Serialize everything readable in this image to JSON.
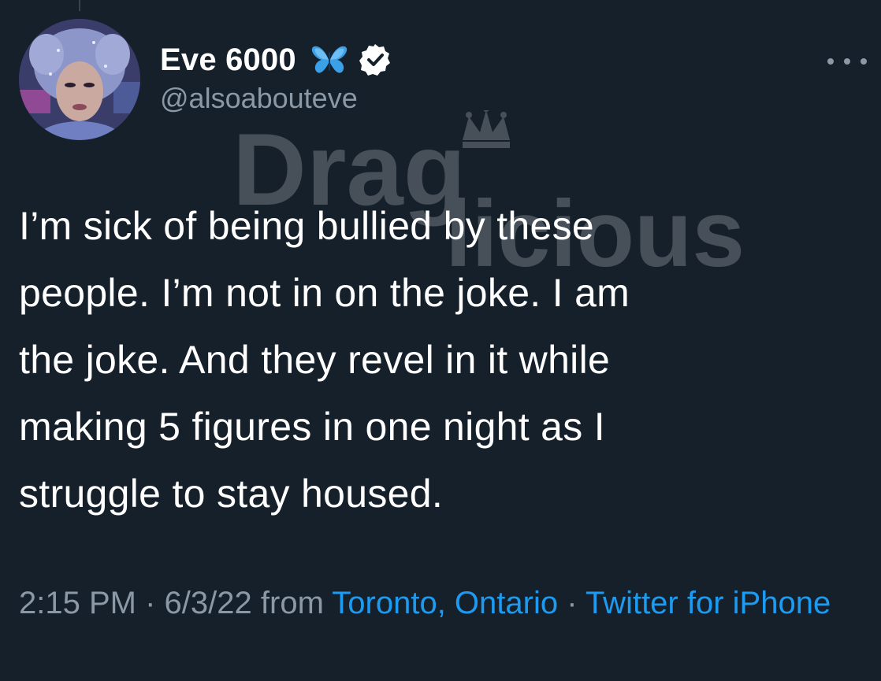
{
  "tweet": {
    "author": {
      "display_name": "Eve 6000",
      "handle": "@alsoabouteve",
      "avatar_icon": "avatar",
      "badge_icons": [
        "butterfly-emoji",
        "verified-badge-icon"
      ]
    },
    "text": "I’m sick of being bullied by these\npeople. I’m not in on the joke. I am\nthe joke. And they revel in it while\nmaking 5 figures in one night as I\nstruggle to stay housed.",
    "time": "2:15 PM",
    "date": "6/3/22",
    "from_label": "from",
    "location": "Toronto, Ontario",
    "separator": "·",
    "client": "Twitter for iPhone"
  },
  "watermark": {
    "text_top": "Drag",
    "text_bottom": "licious"
  },
  "colors": {
    "background": "#15202b",
    "text_primary": "#ffffff",
    "text_secondary": "#8b98a5",
    "link": "#1d9bf0"
  }
}
